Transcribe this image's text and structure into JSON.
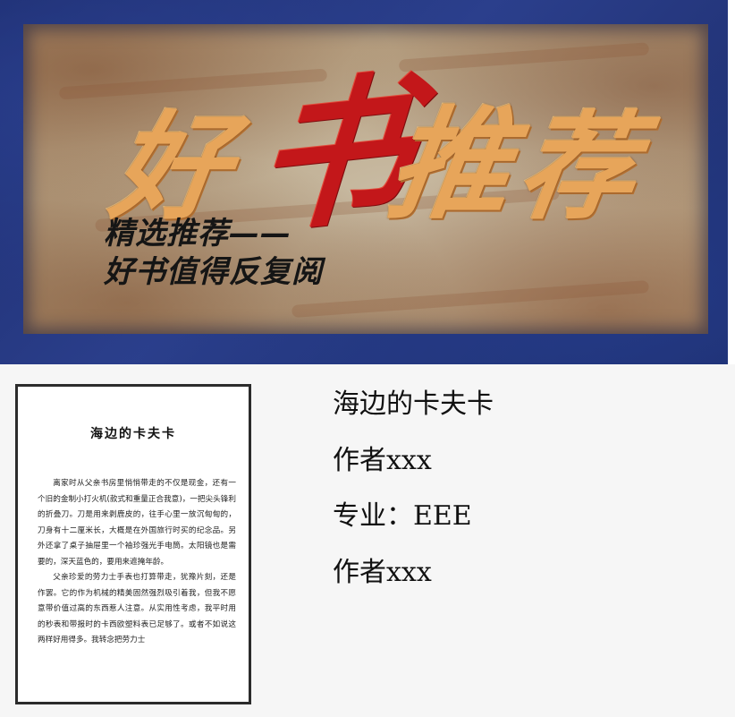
{
  "banner": {
    "title_chars": [
      "好",
      "书",
      "推",
      "荐"
    ],
    "subtitle_line1": "精选推荐——",
    "subtitle_line2": "好书值得反复阅",
    "colors": {
      "frame": "#1f2f72",
      "title_gold": "#e7a55a",
      "title_red": "#c3171a"
    }
  },
  "book": {
    "cover_title": "海边的卡夫卡",
    "paragraphs": [
      "离家时从父亲书房里悄悄带走的不仅是现金，还有一个旧的金制小打火机(款式和重量正合我意)，一把尖头锋利的折叠刀。刀是用来剥鹿皮的，往手心里一放沉甸甸的，刀身有十二厘米长，大概是在外国旅行时买的纪念品。另外还拿了桌子抽屉里一个袖珍强光手电筒。太阳镜也是需要的，深天蓝色的，要用来遮掩年龄。",
      "父亲珍爱的劳力士手表也打算带走，犹豫片刻，还是作罢。它的作为机械的精美固然强烈吸引着我，但我不愿意带价值过高的东西惹人注意。从实用性考虑，我平时用的秒表和带报时的卡西欧塑料表已足够了。或者不如说这两样好用得多。我转念把劳力士"
    ]
  },
  "info": {
    "title": "海边的卡夫卡",
    "author1": "作者xxx",
    "major": "专业：EEE",
    "author2": "作者xxx"
  }
}
